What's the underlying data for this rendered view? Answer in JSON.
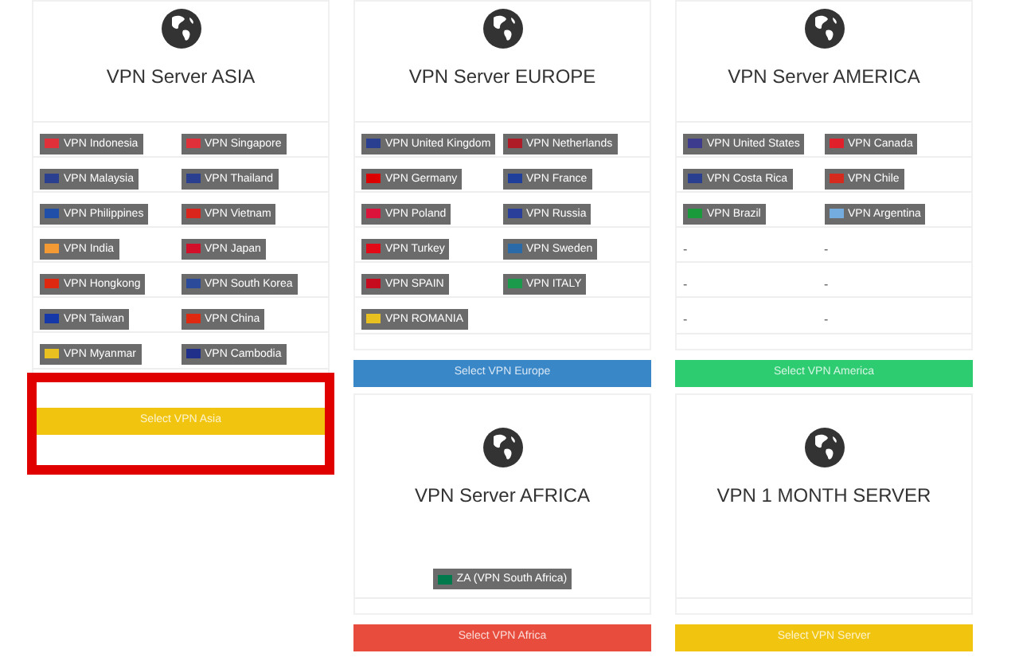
{
  "cards": [
    {
      "title": "VPN Server ASIA",
      "kind": "grid",
      "highlighted": true,
      "rows": [
        [
          {
            "kind": "server",
            "label": "VPN Indonesia",
            "color": "#e0303a"
          },
          {
            "kind": "server",
            "label": "VPN Singapore",
            "color": "#e0303a"
          }
        ],
        [
          {
            "kind": "server",
            "label": "VPN Malaysia",
            "color": "#2a3f8f"
          },
          {
            "kind": "server",
            "label": "VPN Thailand",
            "color": "#2a3f8f"
          }
        ],
        [
          {
            "kind": "server",
            "label": "VPN Philippines",
            "color": "#1f4fa8"
          },
          {
            "kind": "server",
            "label": "VPN Vietnam",
            "color": "#da251d"
          }
        ],
        [
          {
            "kind": "server",
            "label": "VPN India",
            "color": "#f39a35"
          },
          {
            "kind": "server",
            "label": "VPN Japan",
            "color": "#d2102a"
          }
        ],
        [
          {
            "kind": "server",
            "label": "VPN Hongkong",
            "color": "#de2910"
          },
          {
            "kind": "server",
            "label": "VPN South Korea",
            "color": "#2b4a9a"
          }
        ],
        [
          {
            "kind": "server",
            "label": "VPN Taiwan",
            "color": "#1538a8"
          },
          {
            "kind": "server",
            "label": "VPN China",
            "color": "#de2910"
          }
        ],
        [
          {
            "kind": "server",
            "label": "VPN Myanmar",
            "color": "#e8c020"
          },
          {
            "kind": "server",
            "label": "VPN Cambodia",
            "color": "#1f2f8a"
          }
        ]
      ],
      "button": {
        "label": "Select VPN Asia",
        "color": "#f1c40f"
      }
    },
    {
      "title": "VPN Server EUROPE",
      "kind": "grid",
      "rows": [
        [
          {
            "kind": "server",
            "label": "VPN United Kingdom",
            "color": "#2a3f8f"
          },
          {
            "kind": "server",
            "label": "VPN Netherlands",
            "color": "#ae1c28"
          }
        ],
        [
          {
            "kind": "server",
            "label": "VPN Germany",
            "color": "#dd0000"
          },
          {
            "kind": "server",
            "label": "VPN France",
            "color": "#1f3f9a"
          }
        ],
        [
          {
            "kind": "server",
            "label": "VPN Poland",
            "color": "#dc143c"
          },
          {
            "kind": "server",
            "label": "VPN Russia",
            "color": "#2a3f9a"
          }
        ],
        [
          {
            "kind": "server",
            "label": "VPN Turkey",
            "color": "#e30a17"
          },
          {
            "kind": "server",
            "label": "VPN Sweden",
            "color": "#2a6aa8"
          }
        ],
        [
          {
            "kind": "server",
            "label": "VPN SPAIN",
            "color": "#c60b1e"
          },
          {
            "kind": "server",
            "label": "VPN ITALY",
            "color": "#1a9a4a"
          }
        ],
        [
          {
            "kind": "server",
            "label": "VPN ROMANIA",
            "color": "#e8c020"
          }
        ]
      ],
      "button": {
        "label": "Select VPN Europe",
        "color": "#3a87c8"
      }
    },
    {
      "title": "VPN Server AMERICA",
      "kind": "grid",
      "rows": [
        [
          {
            "kind": "server",
            "label": "VPN United States",
            "color": "#3c3b8e"
          },
          {
            "kind": "server",
            "label": "VPN Canada",
            "color": "#e0202a"
          }
        ],
        [
          {
            "kind": "server",
            "label": "VPN Costa Rica",
            "color": "#2a3f8f"
          },
          {
            "kind": "server",
            "label": "VPN Chile",
            "color": "#d52b1e"
          }
        ],
        [
          {
            "kind": "server",
            "label": "VPN Brazil",
            "color": "#1a9a3a"
          },
          {
            "kind": "server",
            "label": "VPN Argentina",
            "color": "#74acdf"
          }
        ],
        [
          {
            "kind": "empty",
            "label": "-"
          },
          {
            "kind": "empty",
            "label": "-"
          }
        ],
        [
          {
            "kind": "empty",
            "label": "-"
          },
          {
            "kind": "empty",
            "label": "-"
          }
        ],
        [
          {
            "kind": "empty",
            "label": "-"
          },
          {
            "kind": "empty",
            "label": "-"
          }
        ]
      ],
      "button": {
        "label": "Select VPN America",
        "color": "#2ecc71"
      }
    },
    {
      "title": "VPN Server AFRICA",
      "kind": "center",
      "rows": [
        [
          {
            "kind": "server",
            "label": "ZA (VPN South Africa)",
            "color": "#007a4d"
          }
        ]
      ],
      "button": {
        "label": "Select VPN Africa",
        "color": "#e74c3c"
      }
    },
    {
      "title": "VPN 1 MONTH SERVER",
      "kind": "center",
      "button": {
        "label": "Select VPN Server",
        "color": "#f1c40f"
      }
    }
  ]
}
